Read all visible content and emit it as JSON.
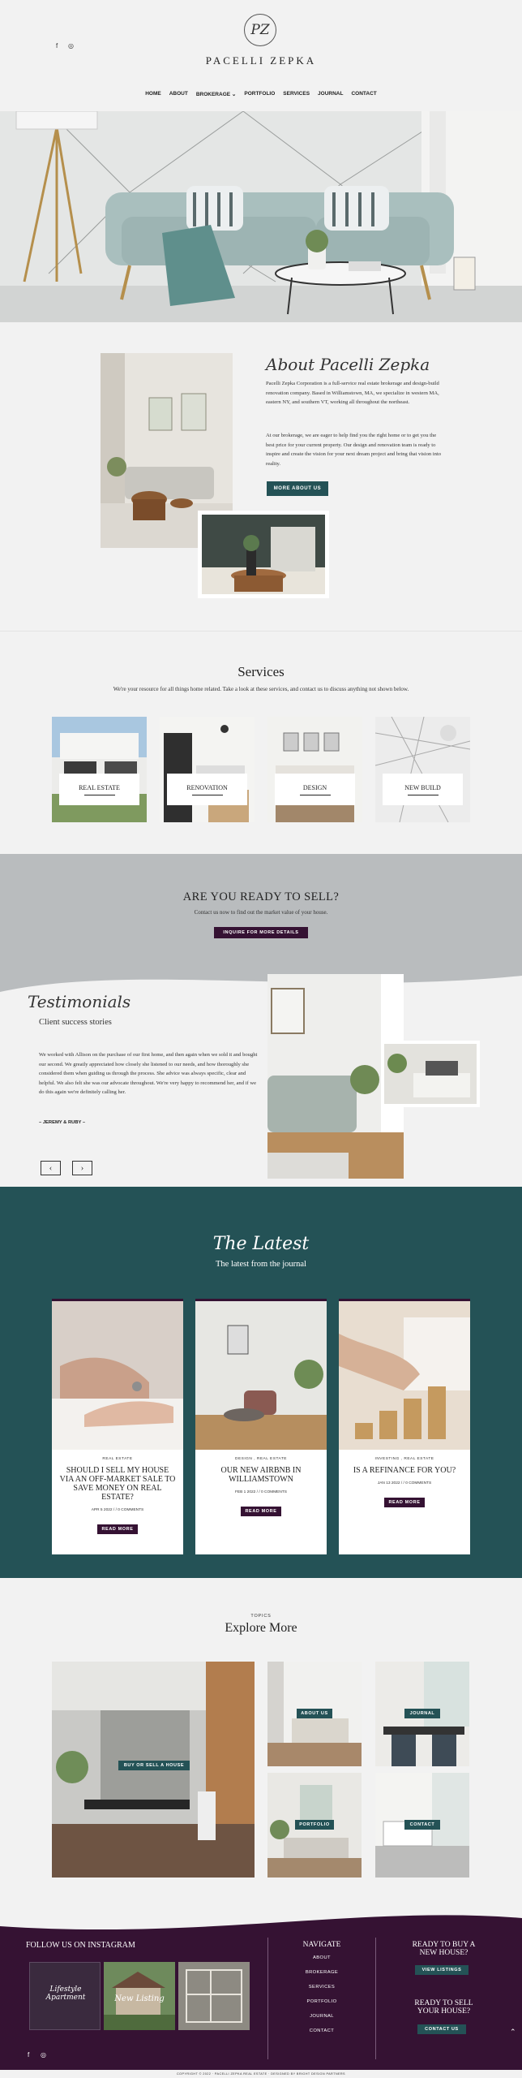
{
  "brand": {
    "logo_mark": "PZ",
    "name": "PACELLI ZEPKA"
  },
  "header": {
    "social": [
      {
        "icon": "facebook-icon",
        "glyph": "f"
      },
      {
        "icon": "instagram-icon",
        "glyph": "◎"
      }
    ]
  },
  "nav": [
    {
      "label": "HOME"
    },
    {
      "label": "ABOUT"
    },
    {
      "label": "BROKERAGE",
      "caret": "⌄"
    },
    {
      "label": "PORTFOLIO"
    },
    {
      "label": "SERVICES"
    },
    {
      "label": "JOURNAL"
    },
    {
      "label": "CONTACT"
    }
  ],
  "about": {
    "title": "About Pacelli Zepka",
    "p1": "Pacelli Zepka Corporation is a full-service real estate brokerage and design-build renovation company. Based in Williamstown, MA, we specialize in western MA, eastern NY, and southern VT, working all throughout the northeast.",
    "p2": "At our brokerage, we are eager to help find you the right home or to get you the best price for your current property. Our design and renovation team is ready to inspire and create the vision for your next dream project and bring that vision into reality.",
    "button": "MORE ABOUT US"
  },
  "services": {
    "title": "Services",
    "subtitle": "We're your resource for all things home related. Take a look at these services, and contact us to discuss anything not shown below.",
    "items": [
      {
        "label": "REAL ESTATE"
      },
      {
        "label": "RENOVATION"
      },
      {
        "label": "DESIGN"
      },
      {
        "label": "NEW BUILD"
      }
    ]
  },
  "sell": {
    "title": "ARE YOU READY TO SELL?",
    "subtitle": "Contact us now to find out the market value of your house.",
    "button": "INQUIRE FOR MORE DETAILS"
  },
  "testimonials": {
    "script_title": "Testimonials",
    "subtitle": "Client success stories",
    "quote": "We worked with Allison on the purchase of our first home, and then again when we sold it and bought our second. We greatly appreciated how closely she listened to our needs, and how thoroughly she considered them when guiding us through the process. She advice was always specific, clear and helpful. We also felt she was our advocate throughout. We're very happy to recommend her, and if we do this again we're definitely calling her.",
    "author": "– JEREMY & RUBY –",
    "prev": "‹",
    "next": "›"
  },
  "latest": {
    "script_title": "The Latest",
    "subtitle": "The latest from the journal",
    "posts": [
      {
        "category": "REAL ESTATE",
        "title": "SHOULD I SELL MY HOUSE VIA AN OFF-MARKET SALE TO SAVE MONEY ON REAL ESTATE?",
        "meta": "APR 5 2022 / / 0 COMMENTS",
        "button": "READ MORE"
      },
      {
        "category": "DESIGN , REAL ESTATE",
        "title": "OUR NEW AIRBNB IN WILLIAMSTOWN",
        "meta": "FEB 1 2022 / / 0 COMMENTS",
        "button": "READ MORE"
      },
      {
        "category": "INVESTING , REAL ESTATE",
        "title": "IS A REFINANCE FOR YOU?",
        "meta": "JAN 13 2022 / / 0 COMMENTS",
        "button": "READ MORE"
      }
    ]
  },
  "explore": {
    "kicker": "TOPICS",
    "title": "Explore More",
    "tiles": [
      {
        "label": "BUY OR SELL A HOUSE"
      },
      {
        "label": "ABOUT US"
      },
      {
        "label": "JOURNAL"
      },
      {
        "label": "PORTFOLIO"
      },
      {
        "label": "CONTACT"
      }
    ]
  },
  "footer": {
    "instagram_title": "FOLLOW US ON INSTAGRAM",
    "insta_posts": [
      {
        "caption": "Lifestyle Apartment"
      },
      {
        "caption": "New Listing"
      },
      {
        "caption": ""
      }
    ],
    "navigate_title": "NAVIGATE",
    "links": [
      "ABOUT",
      "BROKERAGE",
      "SERVICES",
      "PORTFOLIO",
      "JOURNAL",
      "CONTACT"
    ],
    "buy_title": "READY TO BUY A NEW HOUSE?",
    "buy_button": "VIEW LISTINGS",
    "sell_title": "READY TO SELL YOUR HOUSE?",
    "sell_button": "CONTACT US",
    "copyright": "COPYRIGHT © 2022 · PACELLI ZEPKA REAL ESTATE · DESIGNED BY BRIGHT DESIGN PARTNERS",
    "back_to_top": "⌃"
  },
  "colors": {
    "teal": "#245256",
    "plum": "#351233",
    "light": "#f2f2f2",
    "gray": "#b9bcbe"
  }
}
